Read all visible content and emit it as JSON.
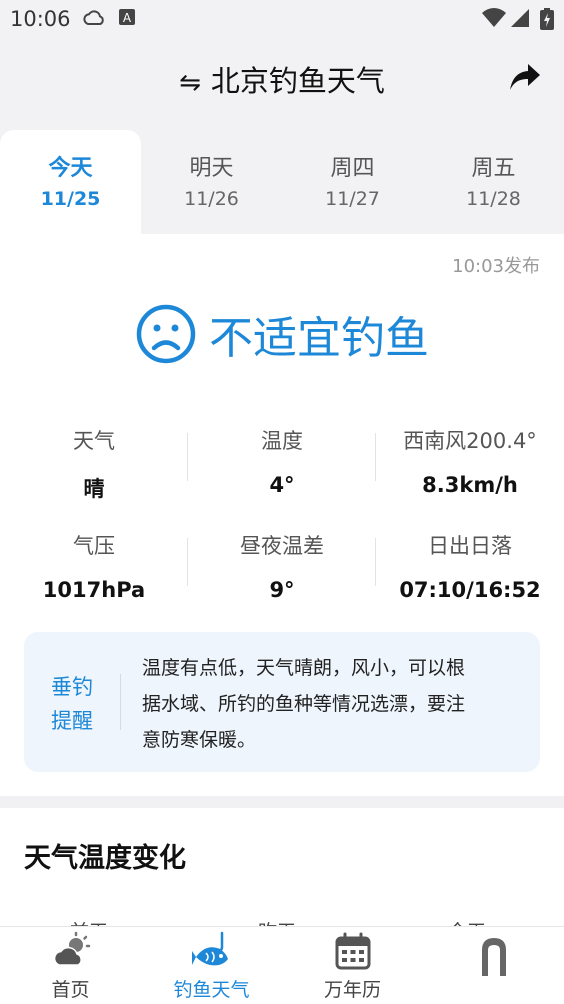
{
  "status_bar": {
    "time": "10:06"
  },
  "header": {
    "title": "北京钓鱼天气",
    "swap_icon": "⇋"
  },
  "tabs": [
    {
      "day": "今天",
      "date": "11/25",
      "active": true
    },
    {
      "day": "明天",
      "date": "11/26",
      "active": false
    },
    {
      "day": "周四",
      "date": "11/27",
      "active": false
    },
    {
      "day": "周五",
      "date": "11/28",
      "active": false
    }
  ],
  "publish_time": "10:03发布",
  "verdict": {
    "text": "不适宜钓鱼",
    "icon": "sad-face-icon"
  },
  "stats": [
    {
      "label": "天气",
      "value": "晴"
    },
    {
      "label": "温度",
      "value": "4°"
    },
    {
      "label": "西南风200.4°",
      "value": "8.3km/h"
    },
    {
      "label": "气压",
      "value": "1017hPa"
    },
    {
      "label": "昼夜温差",
      "value": "9°"
    },
    {
      "label": "日出日落",
      "value": "07:10/16:52"
    }
  ],
  "tip": {
    "tag_line1": "垂钓",
    "tag_line2": "提醒",
    "line1": "温度有点低，天气晴朗，风小，可以根",
    "line2": "据水域、所钓的鱼种等情况选漂，要注",
    "line3": "意防寒保暖。"
  },
  "section": {
    "title": "天气温度变化"
  },
  "chart_labels_cut": [
    "前天",
    "昨天",
    "今天"
  ],
  "navbar": [
    {
      "label": "首页",
      "icon": "weather-cloud-icon",
      "active": false
    },
    {
      "label": "钓鱼天气",
      "icon": "fish-icon",
      "active": true
    },
    {
      "label": "万年历",
      "icon": "calendar-icon",
      "active": false
    },
    {
      "label": "",
      "icon": "arch-icon",
      "active": false
    }
  ],
  "colors": {
    "accent": "#1e88d8",
    "background": "#f2f2f4",
    "tip_bg": "#eef5fc"
  }
}
